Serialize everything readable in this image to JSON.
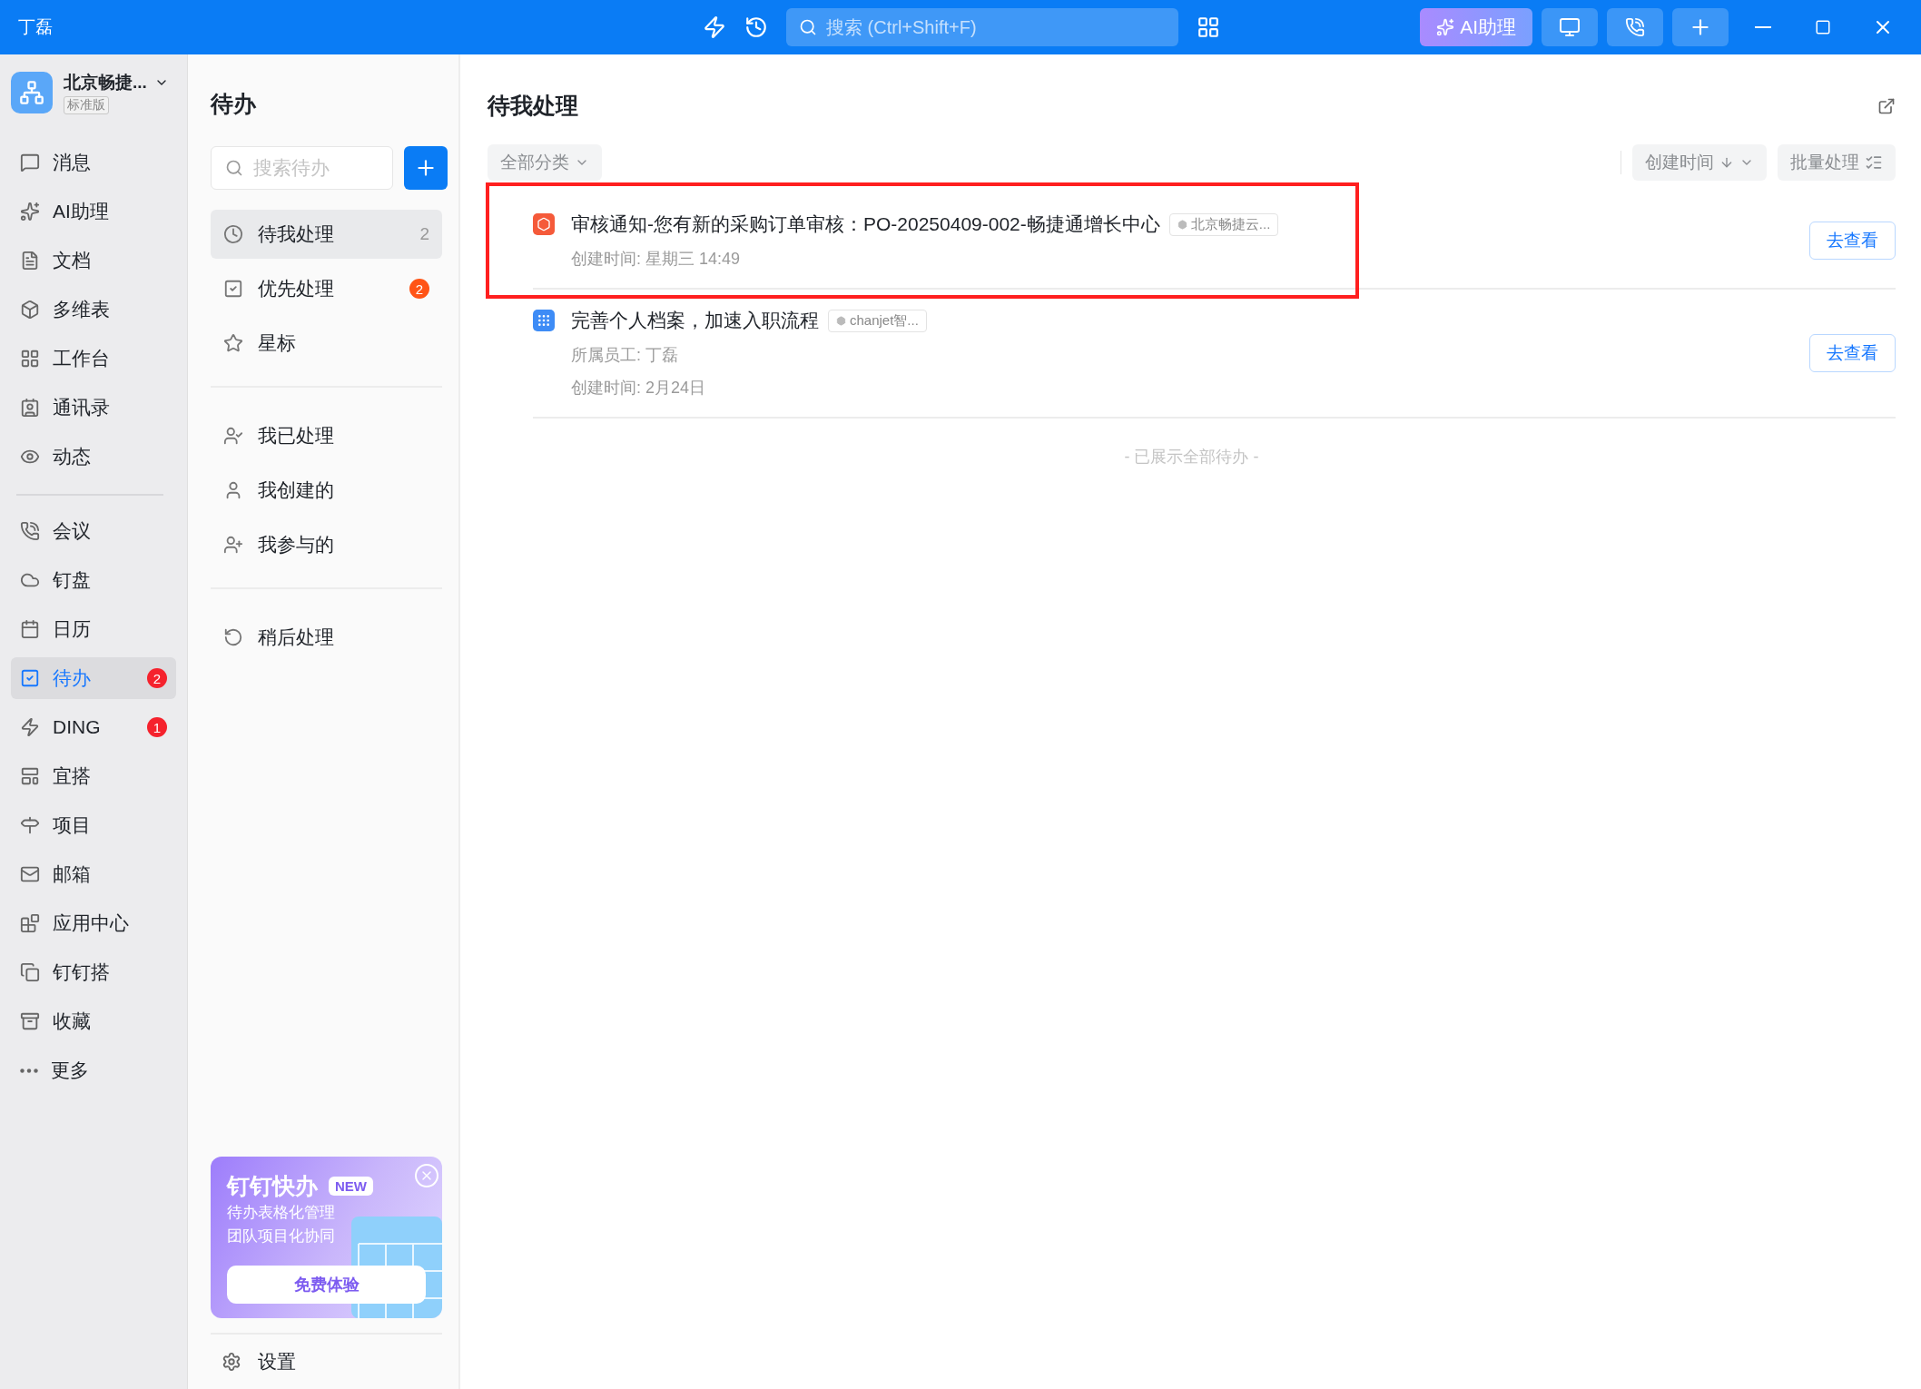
{
  "titlebar": {
    "user": "丁磊",
    "search": {
      "placeholder": "搜索 (Ctrl+Shift+F)"
    },
    "ai_button": "AI助理"
  },
  "org": {
    "name": "北京畅捷...",
    "edition": "标准版"
  },
  "nav_groups": [
    [
      {
        "label": "消息",
        "selected": false
      },
      {
        "label": "AI助理",
        "selected": false
      },
      {
        "label": "文档",
        "selected": false
      },
      {
        "label": "多维表",
        "selected": false
      },
      {
        "label": "工作台",
        "selected": false
      },
      {
        "label": "通讯录",
        "selected": false
      },
      {
        "label": "动态",
        "selected": false
      }
    ],
    [
      {
        "label": "会议",
        "selected": false
      },
      {
        "label": "钉盘",
        "selected": false
      },
      {
        "label": "日历",
        "selected": false
      },
      {
        "label": "待办",
        "selected": true,
        "badge": "2"
      },
      {
        "label": "DING",
        "selected": false,
        "badge": "1"
      },
      {
        "label": "宜搭",
        "selected": false
      },
      {
        "label": "项目",
        "selected": false
      },
      {
        "label": "邮箱",
        "selected": false
      },
      {
        "label": "应用中心",
        "selected": false
      },
      {
        "label": "钉钉搭",
        "selected": false
      },
      {
        "label": "收藏",
        "selected": false
      },
      {
        "label": "更多",
        "selected": false
      }
    ]
  ],
  "todo_panel": {
    "title": "待办",
    "search": {
      "placeholder": "搜索待办"
    },
    "sections": [
      [
        {
          "label": "待我处理",
          "selected": true,
          "count": "2"
        },
        {
          "label": "优先处理",
          "selected": false,
          "badge": "2"
        },
        {
          "label": "星标",
          "selected": false
        }
      ],
      [
        {
          "label": "我已处理",
          "selected": false
        },
        {
          "label": "我创建的",
          "selected": false
        },
        {
          "label": "我参与的",
          "selected": false
        }
      ],
      [
        {
          "label": "稍后处理",
          "selected": false
        }
      ]
    ],
    "promo": {
      "title": "钉钉快办",
      "tag": "NEW",
      "lines": [
        "待办表格化管理",
        "团队项目化协同"
      ],
      "button": "免费体验"
    },
    "settings": "设置"
  },
  "main": {
    "title": "待我处理",
    "filter": "全部分类",
    "sort": "创建时间",
    "batch": "批量处理",
    "items": [
      {
        "kind": "approval",
        "highlighted": true,
        "title": "审核通知-您有新的采购订单审核：PO-20250409-002-畅捷通增长中心",
        "tag": "北京畅捷云...",
        "details": [
          "创建时间: 星期三 14:49"
        ],
        "action": "去查看"
      },
      {
        "kind": "app",
        "highlighted": false,
        "title": "完善个人档案，加速入职流程",
        "tag": "chanjet智...",
        "details": [
          "所属员工: 丁磊",
          "创建时间: 2月24日"
        ],
        "action": "去查看"
      }
    ],
    "footer": "- 已展示全部待办 -"
  }
}
